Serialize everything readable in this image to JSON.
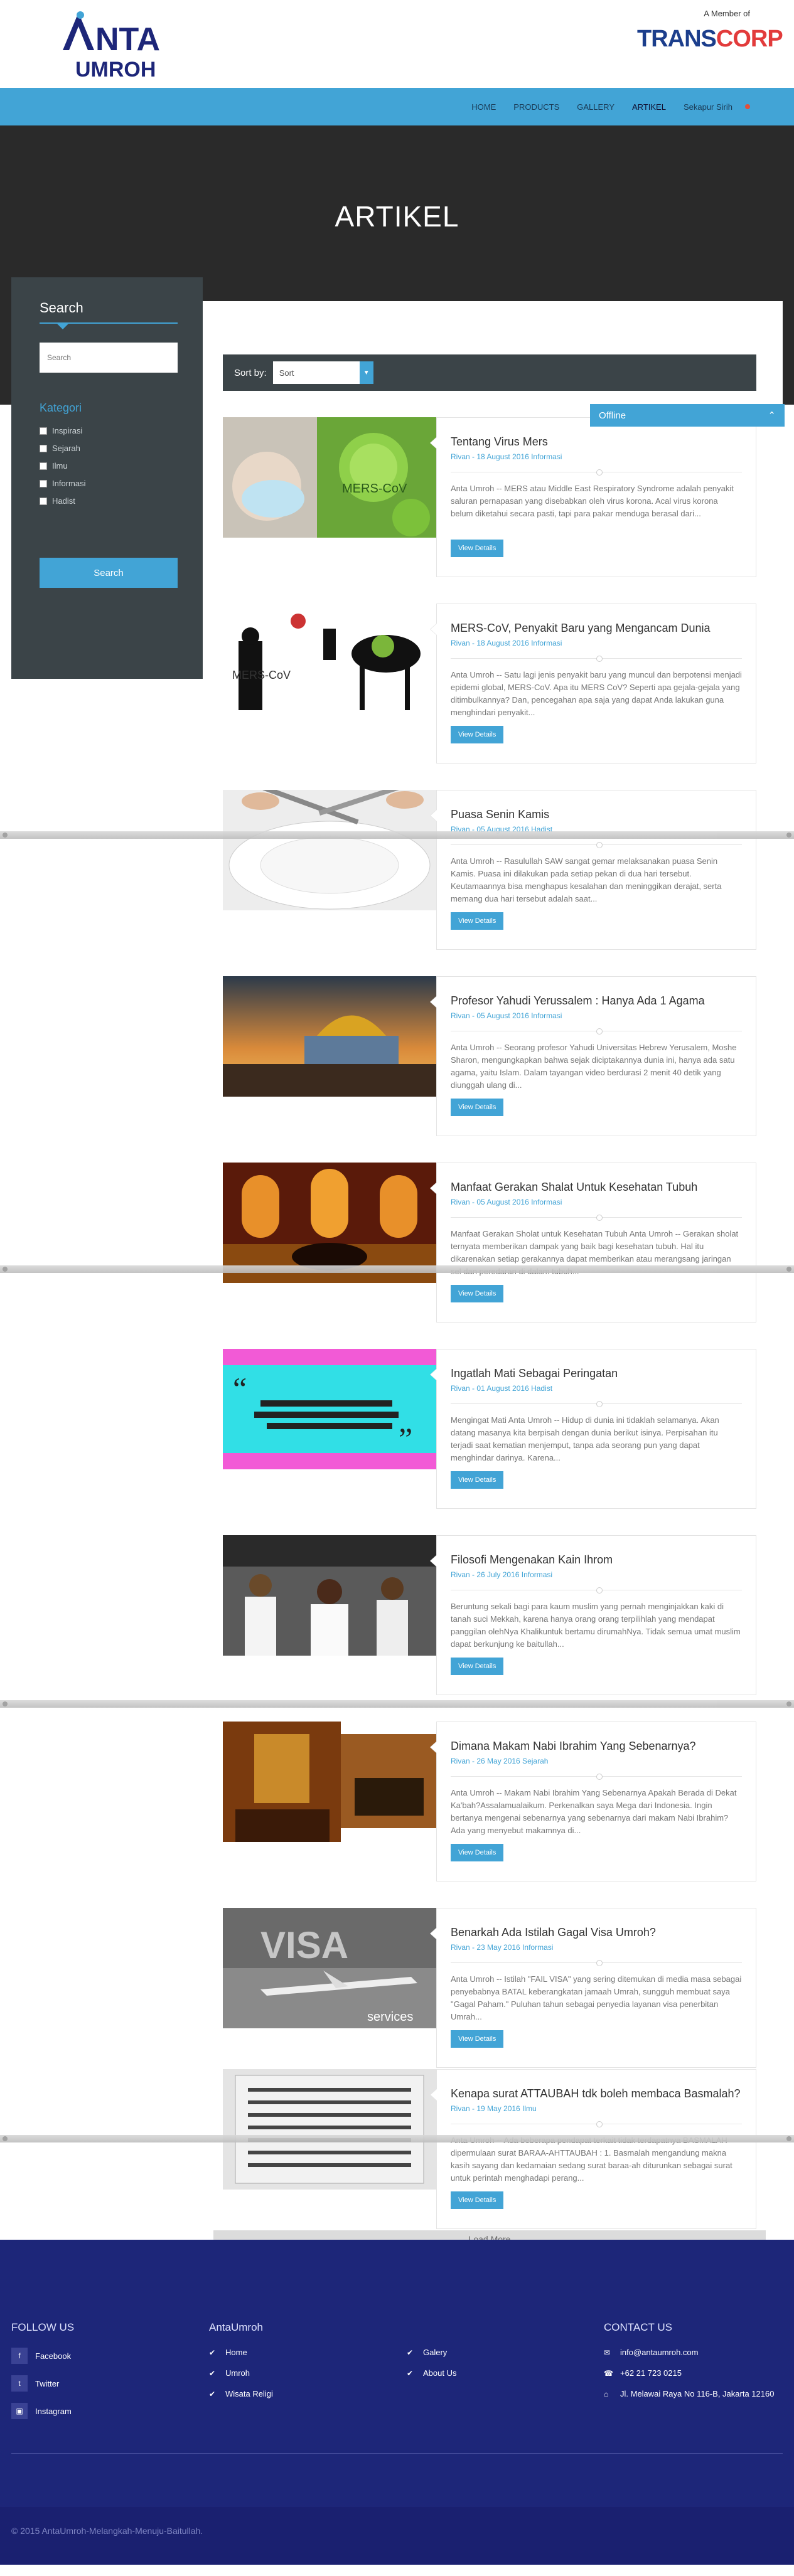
{
  "brand": {
    "logo_word": "NTA",
    "logo_sub": "UMROH",
    "member_label": "A Member of",
    "member_brand_a": "TRANS",
    "member_brand_b": "CORP"
  },
  "nav": {
    "items": [
      "HOME",
      "PRODUCTS",
      "GALLERY",
      "ARTIKEL",
      "Sekapur Sirih"
    ]
  },
  "hero": {
    "title": "ARTIKEL"
  },
  "sidebar": {
    "title": "Search",
    "search_placeholder": "Search",
    "category_title": "Kategori",
    "categories": [
      "Inspirasi",
      "Sejarah",
      "Ilmu",
      "Informasi",
      "Hadist"
    ],
    "search_button": "Search"
  },
  "sort": {
    "label": "Sort by:",
    "value": "Sort"
  },
  "chat": {
    "label": "Offline"
  },
  "articles": [
    {
      "title": "Tentang Virus Mers",
      "meta": "Rivan - 18 August 2016 Informasi",
      "excerpt": "Anta Umroh -- MERS atau Middle East Respiratory Syndrome adalah penyakit saluran pernapasan yang disebabkan oleh virus korona. Acal virus korona belum diketahui secara pasti, tapi para pakar menduga berasal dari...",
      "button": "View Details"
    },
    {
      "title": "MERS-CoV, Penyakit Baru yang Mengancam Dunia",
      "meta": "Rivan - 18 August 2016 Informasi",
      "excerpt": "Anta Umroh -- Satu lagi jenis penyakit baru yang muncul dan berpotensi menjadi epidemi global, MERS-CoV. Apa itu MERS CoV? Seperti apa gejala-gejala yang ditimbulkannya? Dan, pencegahan apa saja yang dapat Anda lakukan guna menghindari penyakit...",
      "button": "View Details"
    },
    {
      "title": "Puasa Senin Kamis",
      "meta": "Rivan - 05 August 2016 Hadist",
      "excerpt": "Anta Umroh -- Rasulullah SAW sangat gemar melaksanakan puasa Senin Kamis. Puasa ini dilakukan pada setiap pekan di dua hari tersebut. Keutamaannya bisa menghapus kesalahan dan meninggikan derajat, serta memang dua hari tersebut adalah saat...",
      "button": "View Details"
    },
    {
      "title": "Profesor Yahudi Yerussalem : Hanya Ada 1 Agama",
      "meta": "Rivan - 05 August 2016 Informasi",
      "excerpt": "Anta Umroh -- Seorang profesor Yahudi Universitas Hebrew Yerusalem, Moshe Sharon, mengungkapkan bahwa sejak diciptakannya dunia ini, hanya ada satu agama, yaitu Islam. Dalam tayangan video berdurasi 2 menit 40 detik yang diunggah ulang di...",
      "button": "View Details"
    },
    {
      "title": "Manfaat Gerakan Shalat Untuk Kesehatan Tubuh",
      "meta": "Rivan - 05 August 2016 Informasi",
      "excerpt": "Manfaat Gerakan Sholat untuk Kesehatan Tubuh Anta Umroh -- Gerakan sholat ternyata memberikan dampak yang baik bagi kesehatan tubuh. Hal itu dikarenakan setiap gerakannya dapat memberikan atau merangsang jaringan sel dan peredaran di dalam tubuh...",
      "button": "View Details"
    },
    {
      "title": "Ingatlah Mati Sebagai Peringatan",
      "meta": "Rivan - 01 August 2016 Hadist",
      "excerpt": "Mengingat Mati Anta Umroh -- Hidup di dunia ini tidaklah selamanya. Akan datang masanya kita berpisah dengan dunia berikut isinya. Perpisahan itu terjadi saat kematian menjemput, tanpa ada seorang pun yang dapat menghindar darinya. Karena...",
      "button": "View Details"
    },
    {
      "title": "Filosofi Mengenakan Kain Ihrom",
      "meta": "Rivan - 26 July 2016 Informasi",
      "excerpt": "Beruntung sekali bagi para kaum muslim yang pernah menginjakkan kaki di tanah suci Mekkah, karena hanya orang orang terpilihlah yang mendapat panggilan olehNya Khalikuntuk bertamu dirumahNya. Tidak semua umat muslim dapat berkunjung ke baitullah...",
      "button": "View Details"
    },
    {
      "title": "Dimana Makam Nabi Ibrahim Yang Sebenarnya?",
      "meta": "Rivan - 26 May 2016 Sejarah",
      "excerpt": "Anta Umroh -- Makam Nabi Ibrahim Yang Sebenarnya Apakah Berada di Dekat Ka'bah?Assalamualaikum. Perkenalkan saya Mega dari Indonesia. Ingin bertanya mengenai sebenarnya yang sebenarnya dari makam Nabi Ibrahim? Ada yang menyebut makamnya di...",
      "button": "View Details"
    },
    {
      "title": "Benarkah Ada Istilah Gagal Visa Umroh?",
      "meta": "Rivan - 23 May 2016 Informasi",
      "excerpt": "Anta Umroh -- Istilah \"FAIL VISA\" yang sering ditemukan di media masa sebagai penyebabnya BATAL keberangkatan jamaah Umrah, sungguh membuat saya \"Gagal Paham.\" Puluhan tahun sebagai penyedia layanan visa penerbitan Umrah...",
      "button": "View Details"
    },
    {
      "title": "Kenapa surat ATTAUBAH tdk boleh membaca Basmalah?",
      "meta": "Rivan - 19 May 2016 Ilmu",
      "excerpt": "Anta Umroh -- Ada beberapa pendapat terkait tidak terdapatnya BASMALAH dipermulaan surat BARAA-AHTTAUBAH : 1. Basmalah mengandung makna kasih sayang dan kedamaian sedang surat baraa-ah diturunkan sebagai surat untuk perintah menghadapi perang...",
      "button": "View Details"
    }
  ],
  "load_more": "Load More",
  "footer": {
    "follow_title": "FOLLOW US",
    "social": [
      "Facebook",
      "Twitter",
      "Instagram"
    ],
    "site_title": "AntaUmroh",
    "links_a": [
      "Home",
      "Umroh",
      "Wisata Religi"
    ],
    "links_b": [
      "Galery",
      "About Us"
    ],
    "contact_title": "CONTACT US",
    "contact": [
      "info@antaumroh.com",
      "+62 21 723 0215",
      "Jl. Melawai Raya No 116-B, Jakarta 12160"
    ],
    "copyright": "© 2015 AntaUmroh-Melangkah-Menuju-Baitullah."
  },
  "colors": {
    "accent": "#42a4d6",
    "dark": "#3b4448",
    "footer": "#1d2679",
    "hero": "#2a2a2a"
  }
}
